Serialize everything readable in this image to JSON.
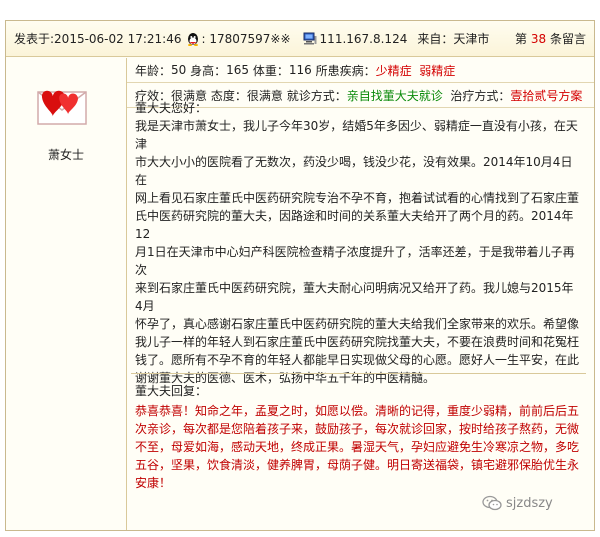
{
  "header": {
    "posted_label": "发表于:",
    "posted_time": "2015-06-02 17:21:46",
    "qq_value": ": 17807597※※",
    "ip_value": "111.167.8.124",
    "from_label": "来自：",
    "from_value": "天津市",
    "msg_prefix": "第",
    "msg_number": "38",
    "msg_suffix": "条留言"
  },
  "user": {
    "name": "萧女士",
    "avatar_icon": "envelope-hearts-icon"
  },
  "info": {
    "age_label": "年龄：",
    "age": "50",
    "height_label": "身高：",
    "height": "165",
    "weight_label": "体重：",
    "weight": "116",
    "disease_label": "所患疾病：",
    "disease1": "少精症",
    "disease2": "弱精症",
    "effect_label": "疗效：",
    "effect": "很满意",
    "attitude_label": "态度：",
    "attitude": "很满意",
    "visit_label": "就诊方式：",
    "visit": "亲自找董大夫就诊",
    "treat_label": "治疗方式：",
    "treat": "壹拾贰号方案"
  },
  "letter": {
    "greeting": "董大夫您好：",
    "lines": [
      "我是天津市萧女士，我儿子今年30岁，结婚5年多因少、弱精症一直没有小孩，在天津",
      "市大大小小的医院看了无数次，药没少喝，钱没少花，没有效果。2014年10月4日在",
      "网上看见石家庄董氏中医药研究院专治不孕不育，抱着试试看的心情找到了石家庄董",
      "氏中医药研究院的董大夫，因路途和时间的关系董大夫给开了两个月的药。2014年12",
      "月1日在天津市中心妇产科医院检查精子浓度提升了，活率还差，于是我带着儿子再次",
      "来到石家庄董氏中医药研究院，董大夫耐心问明病况又给开了药。我儿媳与2015年4月",
      "怀孕了，真心感谢石家庄董氏中医药研究院的董大夫给我们全家带来的欢乐。希望像",
      "我儿子一样的年轻人到石家庄董氏中医药研究院找董大夫，不要在浪费时间和花冤枉",
      "钱了。愿所有不孕不育的年轻人都能早日实现做父母的心愿。愿好人一生平安，在此",
      "谢谢董大夫的医德、医术，弘扬中华五千年的中医精髓。"
    ]
  },
  "reply": {
    "label": "董大夫回复：",
    "lines": [
      "恭喜恭喜！知命之年，孟夏之时，如愿以偿。清晰的记得，重度少弱精，前前后后五",
      "次亲诊，每次都是您陪着孩子来，鼓励孩子，每次就诊回家，按时给孩子熬药，无微",
      "不至，母爱如海，感动天地，终成正果。暑湿天气，孕妇应避免生冷寒凉之物，多吃",
      "五谷，坚果，饮食清淡，健养脾胃，母荫子健。明日寄送福袋，镇宅避邪保胎优生永",
      "安康！"
    ]
  },
  "watermark": {
    "text": "sjzdszy",
    "icon": "wechat-icon"
  },
  "colors": {
    "accent_red": "#d40000",
    "green": "#0a8a0a",
    "reply_red": "#c00000",
    "border": "#c9b98e"
  }
}
